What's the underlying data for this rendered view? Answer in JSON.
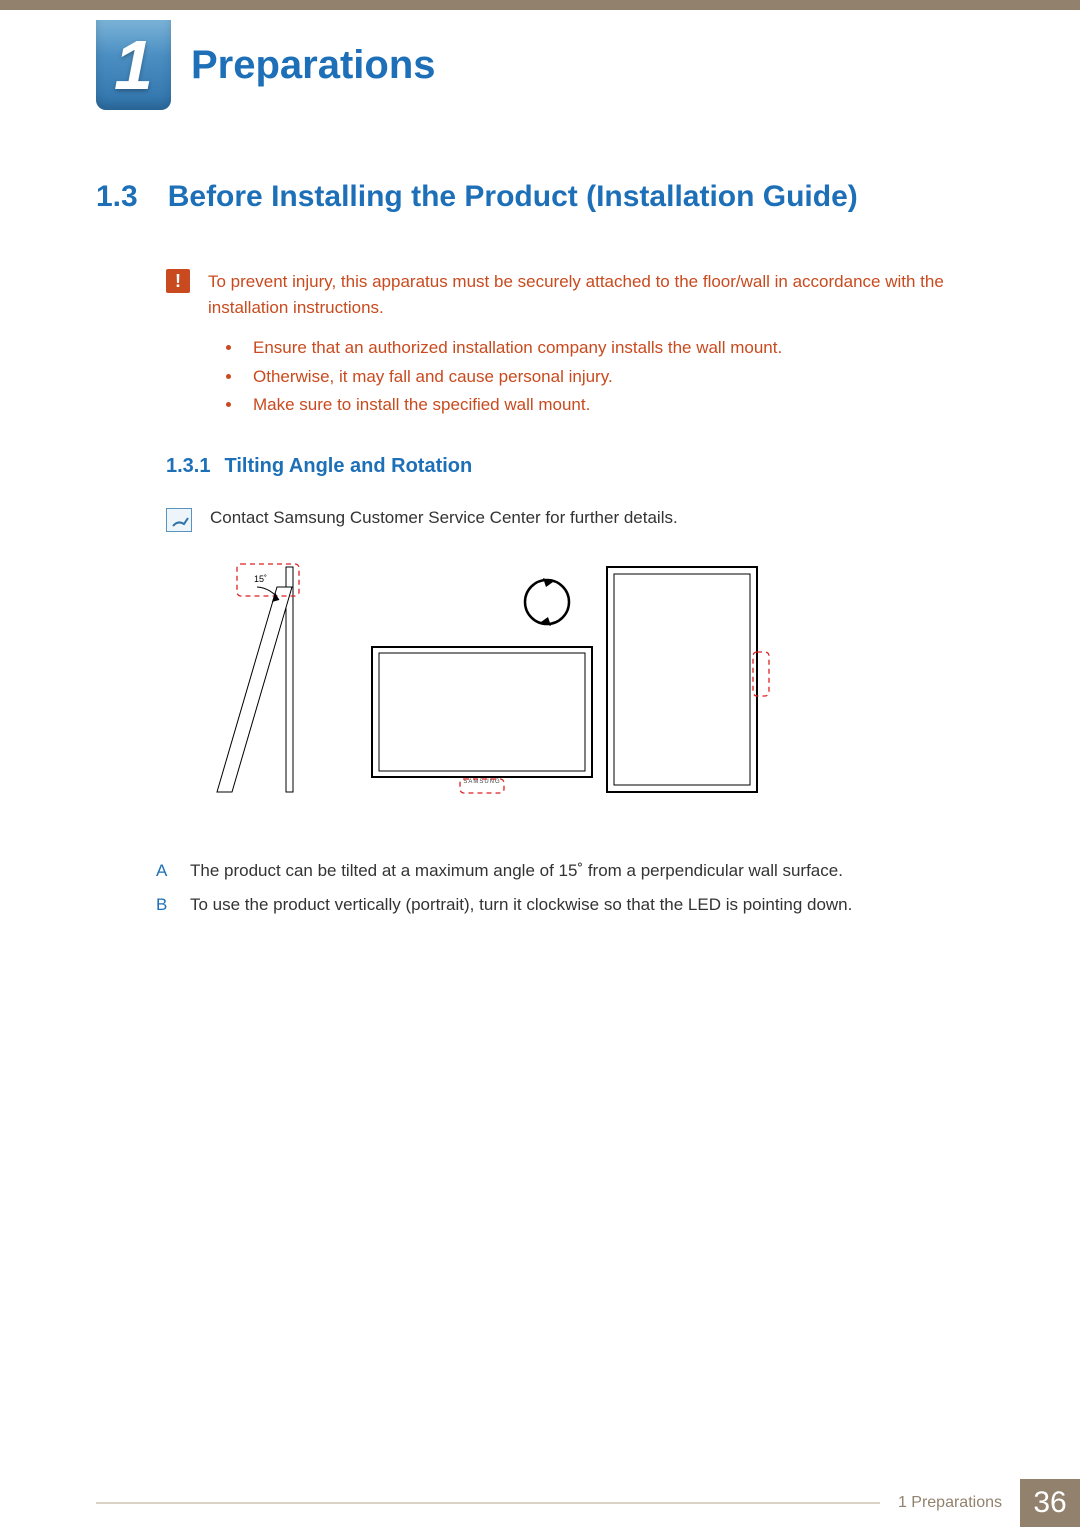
{
  "chapter": {
    "number": "1",
    "title": "Preparations"
  },
  "section": {
    "number": "1.3",
    "title": "Before Installing the Product (Installation Guide)"
  },
  "warning": {
    "intro": "To prevent injury, this apparatus must be securely attached to the floor/wall in accordance with the installation instructions.",
    "items": [
      "Ensure that an authorized installation company installs the wall mount.",
      "Otherwise, it may fall and cause personal injury.",
      "Make sure to install the specified wall mount."
    ]
  },
  "subsection": {
    "number": "1.3.1",
    "title": "Tilting Angle and Rotation",
    "note": "Contact Samsung Customer Service Center for further details.",
    "angle_label": "15˚",
    "brand_label": "SAMSUNG"
  },
  "points": {
    "A": "The product can be tilted at a maximum angle of 15˚ from a perpendicular wall surface.",
    "B": "To use the product vertically (portrait), turn it clockwise so that the LED is pointing down."
  },
  "footer": {
    "section_ref": "1 Preparations",
    "page": "36"
  }
}
